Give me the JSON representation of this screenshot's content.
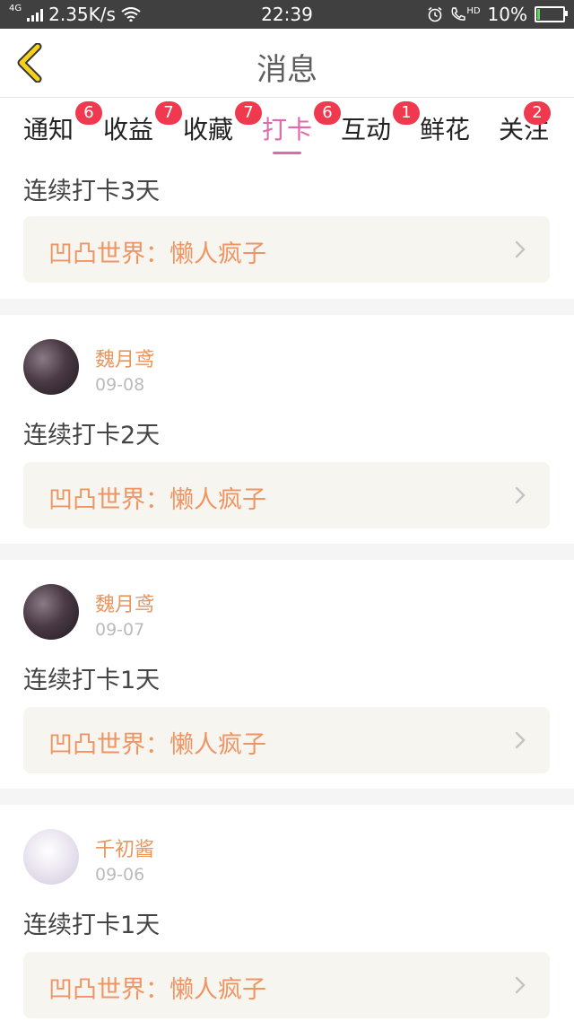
{
  "status_bar": {
    "network_label": "4G",
    "speed": "2.35K/s",
    "time": "22:39",
    "hd_label": "HD",
    "battery": "10%",
    "battery_level": 0.1
  },
  "header": {
    "title": "消息"
  },
  "tabs": [
    {
      "label": "通知",
      "badge": "6",
      "active": false
    },
    {
      "label": "收益",
      "badge": "7",
      "active": false
    },
    {
      "label": "收藏",
      "badge": "7",
      "active": false
    },
    {
      "label": "打卡",
      "badge": "6",
      "active": true
    },
    {
      "label": "互动",
      "badge": "1",
      "active": false
    },
    {
      "label": "鲜花",
      "badge": "",
      "active": false
    },
    {
      "label": "关注",
      "badge": "2",
      "active": false
    }
  ],
  "cards": [
    {
      "user": "",
      "date": "",
      "text": "连续打卡3天",
      "reference": "凹凸世界：懒人疯子"
    },
    {
      "user": "魏月鸢",
      "date": "09-08",
      "text": "连续打卡2天",
      "reference": "凹凸世界：懒人疯子"
    },
    {
      "user": "魏月鸢",
      "date": "09-07",
      "text": "连续打卡1天",
      "reference": "凹凸世界：懒人疯子"
    },
    {
      "user": "千初酱",
      "date": "09-06",
      "text": "连续打卡1天",
      "reference": "凹凸世界：懒人疯子"
    }
  ],
  "colors": {
    "accent": "#e06aa8",
    "badge": "#f0384f",
    "reference_text": "#ef9564",
    "username": "#e8955f"
  }
}
